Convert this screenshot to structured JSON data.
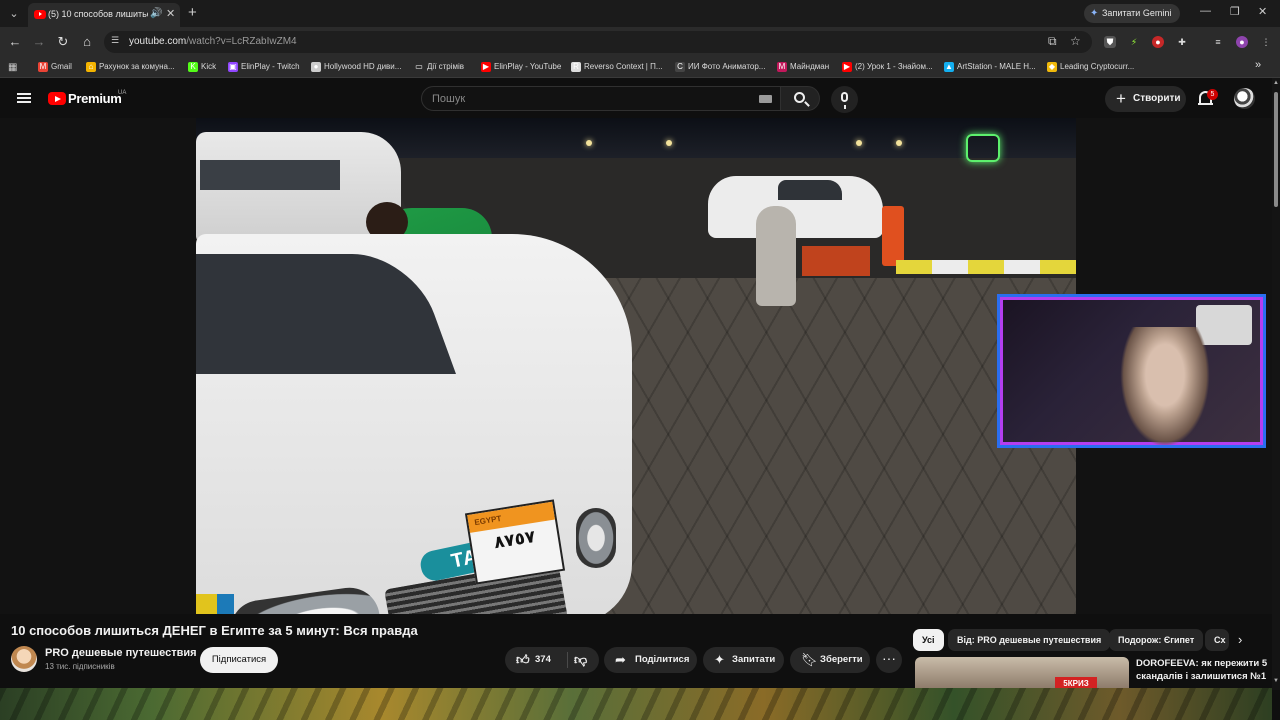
{
  "browser": {
    "tab_title": "(5) 10 способов лишиться",
    "gemini_label": "Запитати Gemini",
    "url_domain": "youtube.com",
    "url_path": "/watch?v=LcRZabIwZM4",
    "bookmarks": [
      {
        "label": "Gmail",
        "icon": "gmail-icon",
        "color": "#ea4335",
        "glyph": "M"
      },
      {
        "label": "Рахунок за комуна...",
        "icon": "home-icon",
        "color": "#f4b400",
        "glyph": "⌂"
      },
      {
        "label": "Kick",
        "icon": "kick-icon",
        "color": "#53fc18",
        "glyph": "K"
      },
      {
        "label": "ElinPlay - Twitch",
        "icon": "twitch-icon",
        "color": "#9146ff",
        "glyph": "▣"
      },
      {
        "label": "Hollywood HD диви...",
        "icon": "globe-icon",
        "color": "#cccccc",
        "glyph": "●"
      },
      {
        "label": "Дії стрімів",
        "icon": "folder-icon",
        "color": "#2b2b2b",
        "glyph": "▭"
      },
      {
        "label": "ElinPlay - YouTube",
        "icon": "youtube-icon",
        "color": "#ff0000",
        "glyph": "▶"
      },
      {
        "label": "Reverso Context | П...",
        "icon": "reverso-icon",
        "color": "#dddddd",
        "glyph": "R"
      },
      {
        "label": "ИИ Фото Аниматор...",
        "icon": "animator-icon",
        "color": "#444444",
        "glyph": "C"
      },
      {
        "label": "Майндман",
        "icon": "mindman-icon",
        "color": "#c2185b",
        "glyph": "M"
      },
      {
        "label": "(2) Урок 1 - Знайом...",
        "icon": "youtube-icon",
        "color": "#ff0000",
        "glyph": "▶"
      },
      {
        "label": "ArtStation - MALE H...",
        "icon": "artstation-icon",
        "color": "#13aff0",
        "glyph": "▲"
      },
      {
        "label": "Leading Cryptocurr...",
        "icon": "crypto-icon",
        "color": "#f0b90b",
        "glyph": "◆"
      }
    ]
  },
  "yt_header": {
    "brand": "Premium",
    "region": "UA",
    "search_placeholder": "Пошук",
    "create_label": "Створити",
    "notifications": "5"
  },
  "video": {
    "taxi_sign": "TAXI",
    "plate_top": "EGYPT",
    "plate_number": "٨٧٥٧"
  },
  "meta": {
    "title": "10 способов лишиться ДЕНЕГ в Египте за 5 минут: Вся правда",
    "channel_name": "PRO дешевые путешествия",
    "subscribers": "13 тис. підписників",
    "subscribe_label": "Підписатися",
    "likes": "374",
    "share_label": "Поділитися",
    "ask_label": "Запитати",
    "save_label": "Зберегти"
  },
  "chips": [
    {
      "label": "Усі",
      "active": true
    },
    {
      "label": "Від: PRO дешевые путешествия",
      "active": false
    },
    {
      "label": "Подорож: Єгипет",
      "active": false
    },
    {
      "label": "Сх",
      "active": false
    }
  ],
  "recommendation": {
    "title": "DOROFEEVA: як пережити 5 скандалів і залишитися №1",
    "thumb_badge": "5КРИЗ"
  }
}
